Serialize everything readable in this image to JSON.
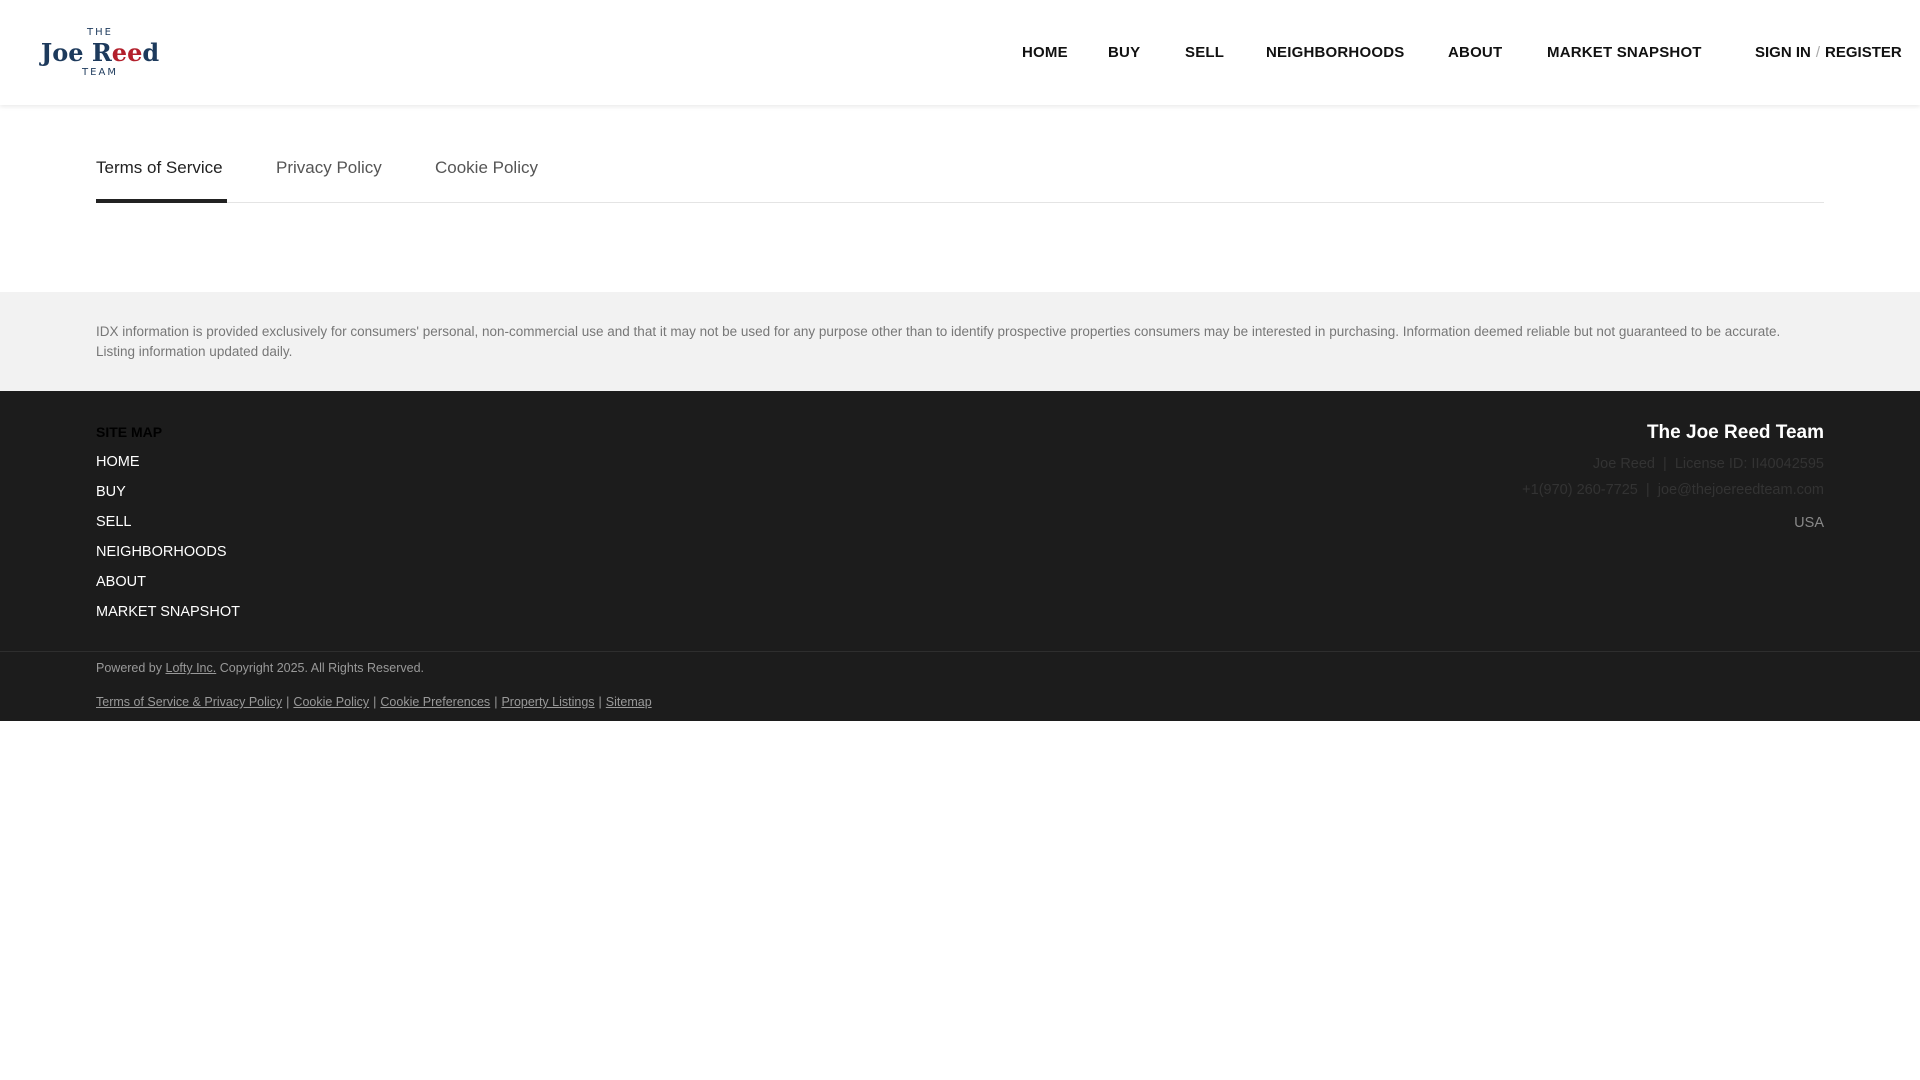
{
  "logo": {
    "top_text": "THE",
    "name_part1": "Joe R",
    "name_accent": "ee",
    "name_part2": "d",
    "bottom_text": "TEAM"
  },
  "nav": {
    "items": [
      {
        "label": "HOME"
      },
      {
        "label": "BUY"
      },
      {
        "label": "SELL"
      },
      {
        "label": "NEIGHBORHOODS"
      },
      {
        "label": "ABOUT"
      },
      {
        "label": "MARKET SNAPSHOT"
      }
    ],
    "sign_in": "SIGN IN",
    "separator": "/",
    "register": "REGISTER"
  },
  "tabs": [
    {
      "label": "Terms of Service",
      "active": true
    },
    {
      "label": "Privacy Policy",
      "active": false
    },
    {
      "label": "Cookie Policy",
      "active": false
    }
  ],
  "disclaimer": {
    "text": "IDX information is provided exclusively for consumers' personal, non-commercial use and that it may not be used for any purpose other than to identify prospective properties consumers may be interested in purchasing. Information deemed reliable but not guaranteed to be accurate. Listing information updated daily."
  },
  "footer": {
    "sitemap_title": "SITE MAP",
    "sitemap_items": [
      {
        "label": "HOME"
      },
      {
        "label": "BUY"
      },
      {
        "label": "SELL"
      },
      {
        "label": "NEIGHBORHOODS"
      },
      {
        "label": "ABOUT"
      },
      {
        "label": "MARKET SNAPSHOT"
      }
    ],
    "contact": {
      "team_name": "The Joe Reed Team",
      "agent_line": "Joe Reed  |  License ID: II40042595",
      "phone_email_line": "+1(970) 260-7725  |  joe@thejoereedteam.com",
      "country": "USA"
    },
    "powered_prefix": "Powered by",
    "powered_link": "Lofty Inc.",
    "copyright": "Copyright 2025. All Rights Reserved.",
    "legal_links": [
      {
        "label": "Terms of Service & Privacy Policy"
      },
      {
        "label": "Cookie Policy"
      },
      {
        "label": "Cookie Preferences"
      },
      {
        "label": "Property Listings"
      },
      {
        "label": "Sitemap"
      }
    ],
    "legal_separator": "|"
  },
  "colors": {
    "brand_navy": "#1d3a5c",
    "brand_red": "#b3202c",
    "footer_bg": "#1c1c1c",
    "disclaimer_bg": "#f2f2f2"
  }
}
